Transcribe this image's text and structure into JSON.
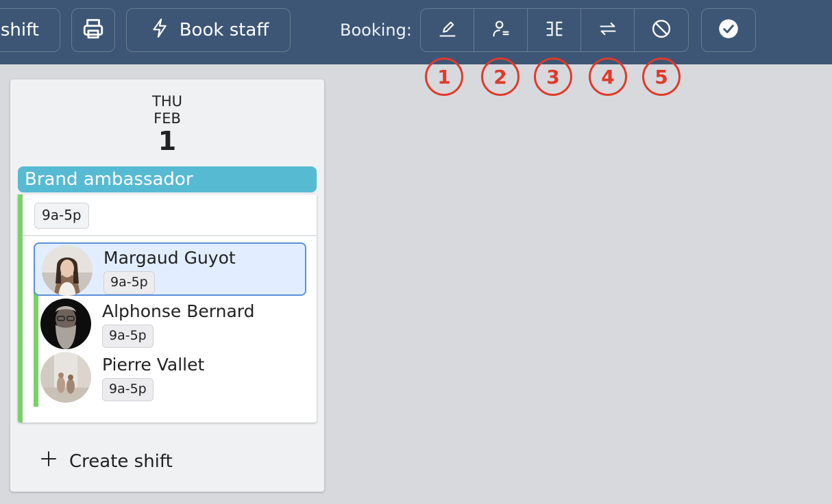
{
  "toolbar": {
    "shift_label": "shift",
    "book_staff_label": "Book staff",
    "booking_label": "Booking:",
    "booking_actions": [
      {
        "icon": "edit-icon",
        "marker": "1"
      },
      {
        "icon": "user-assign-icon",
        "marker": "2"
      },
      {
        "icon": "split-icon",
        "marker": "3"
      },
      {
        "icon": "swap-icon",
        "marker": "4"
      },
      {
        "icon": "cancel-icon",
        "marker": "5"
      }
    ],
    "colors": {
      "background": "#3d5675",
      "marker": "#e03a2a"
    }
  },
  "day": {
    "weekday": "THU",
    "month": "FEB",
    "date": "1"
  },
  "role": {
    "name": "Brand ambassador",
    "color": "#57bad3",
    "shift_time": "9a-5p"
  },
  "staff": [
    {
      "name": "Margaud Guyot",
      "time": "9a-5p",
      "selected": true
    },
    {
      "name": "Alphonse Bernard",
      "time": "9a-5p",
      "selected": false
    },
    {
      "name": "Pierre Vallet",
      "time": "9a-5p",
      "selected": false
    }
  ],
  "create_shift_label": "Create shift"
}
